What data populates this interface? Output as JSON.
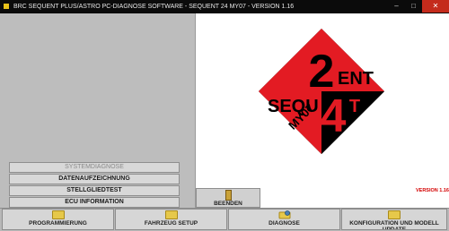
{
  "window": {
    "title": "BRC SEQUENT PLUS/ASTRO PC-DIAGNOSE SOFTWARE - SEQUENT 24 MY07 - VERSION 1.16",
    "minimize_glyph": "–",
    "maximize_glyph": "□",
    "close_glyph": "✕"
  },
  "menu": {
    "items": [
      {
        "label": "SYSTEMDIAGNOSE",
        "enabled": false
      },
      {
        "label": "DATENAUFZEICHNUNG",
        "enabled": true
      },
      {
        "label": "STELLGLIEDTEST",
        "enabled": true
      },
      {
        "label": "ECU INFORMATION",
        "enabled": true
      }
    ]
  },
  "logo": {
    "brand_top": "SEQU",
    "brand_ent": "ENT",
    "number_2": "2",
    "number_4": "4",
    "model_year": "MY07",
    "colors": {
      "red": "#e31b23",
      "black": "#000000"
    }
  },
  "version": "VERSION 1.16",
  "exit_button": {
    "label": "BEENDEN",
    "icon": "door-icon"
  },
  "bottom_buttons": [
    {
      "label": "PROGRAMMIERUNG",
      "icon": "folder-icon"
    },
    {
      "label": "FAHRZEUG SETUP",
      "icon": "folder-icon"
    },
    {
      "label": "DIAGNOSE",
      "icon": "diagnose-icon"
    },
    {
      "label": "KONFIGURATION UND MODELL UPDATE",
      "icon": "folder-icon"
    }
  ]
}
